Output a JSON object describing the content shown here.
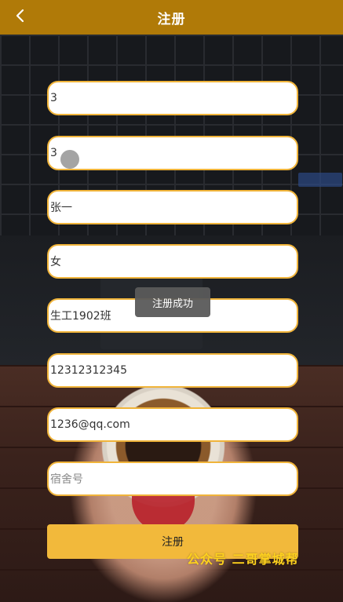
{
  "header": {
    "title": "注册",
    "back_icon": "chevron-left-icon"
  },
  "form": {
    "fields": [
      {
        "value": "3",
        "placeholder": "",
        "is_placeholder": false
      },
      {
        "value": "3",
        "placeholder": "",
        "is_placeholder": false
      },
      {
        "value": "张一",
        "placeholder": "",
        "is_placeholder": false
      },
      {
        "value": "女",
        "placeholder": "",
        "is_placeholder": false
      },
      {
        "value": "生工1902班",
        "placeholder": "",
        "is_placeholder": false
      },
      {
        "value": "12312312345",
        "placeholder": "",
        "is_placeholder": false
      },
      {
        "value": "1236@qq.com",
        "placeholder": "",
        "is_placeholder": false
      },
      {
        "value": "",
        "placeholder": "宿舍号",
        "is_placeholder": true
      }
    ],
    "submit_label": "注册"
  },
  "toast": {
    "text": "注册成功"
  },
  "watermark": {
    "text": "公众号 二哥掌城帮"
  },
  "colors": {
    "header_bg": "#b07a08",
    "field_border": "#f0b43a",
    "submit_bg": "#f2b93b",
    "watermark": "#ffd21e"
  }
}
